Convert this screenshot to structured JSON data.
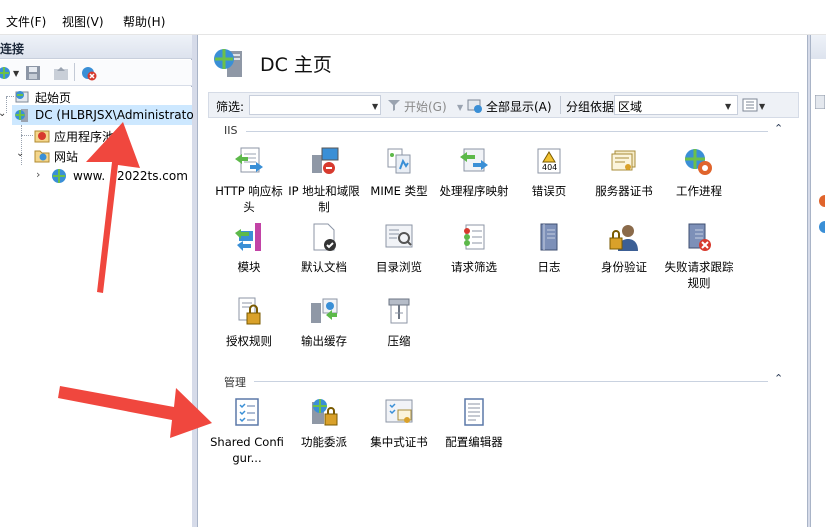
{
  "menu": {
    "file": "文件(F)",
    "view": "视图(V)",
    "help": "帮助(H)"
  },
  "left": {
    "title": "连接",
    "tree": {
      "start_page": "起始页",
      "server": "DC (HLBRJSX\\Administrato",
      "app_pools": "应用程序池",
      "sites": "网站",
      "site_partial_left": "www.",
      "site_partial_right": "2022ts.com"
    }
  },
  "content": {
    "title": "DC 主页",
    "filter": {
      "label": "筛选:",
      "go": "开始(G)",
      "show_all": "全部显示(A)",
      "group_by": "分组依据:",
      "group_value": "区域"
    },
    "groups": {
      "iis": {
        "label": "IIS",
        "items": [
          "HTTP 响应标头",
          "IP 地址和域限制",
          "MIME 类型",
          "处理程序映射",
          "错误页",
          "服务器证书",
          "工作进程",
          "模块",
          "默认文档",
          "目录浏览",
          "请求筛选",
          "日志",
          "身份验证",
          "失败请求跟踪规则",
          "授权规则",
          "输出缓存",
          "压缩"
        ]
      },
      "management": {
        "label": "管理",
        "items": [
          "Shared Configur...",
          "功能委派",
          "集中式证书",
          "配置编辑器"
        ]
      }
    }
  },
  "colors": {
    "selection": "#cde8ff",
    "arrow": "#f0473e",
    "panel_border": "#a9b4c7"
  }
}
